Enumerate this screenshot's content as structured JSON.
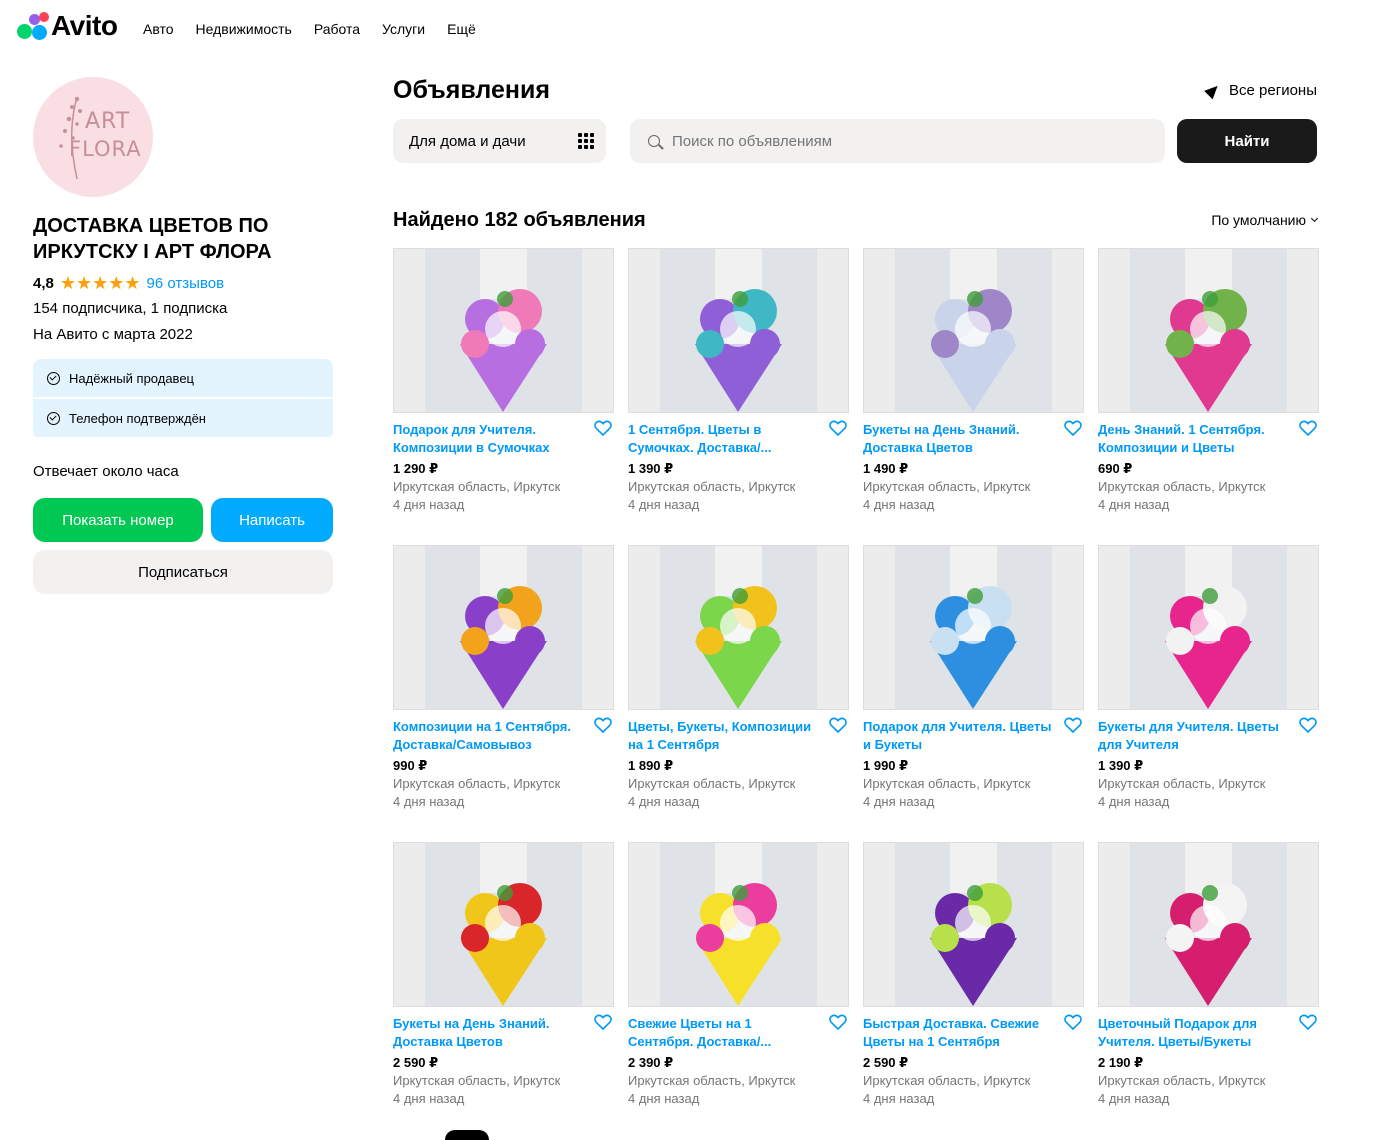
{
  "brand": {
    "logo_text": "Avito"
  },
  "nav": [
    "Авто",
    "Недвижимость",
    "Работа",
    "Услуги",
    "Ещё"
  ],
  "seller": {
    "avatar_text_1": "ART",
    "avatar_text_2": "FLORA",
    "name": "ДОСТАВКА ЦВЕТОВ ПО ИРКУТСКУ I АРТ ФЛОРА",
    "rating": "4,8",
    "stars": "★★★★★",
    "reviews": "96 отзывов",
    "subscribers": "154 подписчика, 1 подписка",
    "since": "На Авито с марта 2022",
    "badges": [
      "Надёжный продавец",
      "Телефон подтверждён"
    ],
    "reply_time": "Отвечает около часа",
    "show_phone": "Показать номер",
    "write": "Написать",
    "subscribe": "Подписаться"
  },
  "main": {
    "title": "Объявления",
    "region": "Все регионы",
    "category": "Для дома и дачи",
    "search_placeholder": "Поиск по объявлениям",
    "find": "Найти",
    "found": "Найдено 182 объявления",
    "sort": "По умолчанию"
  },
  "colors": {
    "accent_blue": "#0099f7",
    "green": "#00c853",
    "star": "#ffa000"
  },
  "listings": [
    {
      "title": "Подарок для Учителя. Композиции в Сумочках",
      "price": "1 290 ₽",
      "location": "Иркутская область, Иркутск",
      "date": "4 дня назад",
      "c1": "#b66ee0",
      "c2": "#f07ab8"
    },
    {
      "title": "1 Сентября. Цветы в Сумочках. Доставка/...",
      "price": "1 390 ₽",
      "location": "Иркутская область, Иркутск",
      "date": "4 дня назад",
      "c1": "#8e5fd6",
      "c2": "#3fb7c4"
    },
    {
      "title": "Букеты на День Знаний. Доставка Цветов",
      "price": "1 490 ₽",
      "location": "Иркутская область, Иркутск",
      "date": "4 дня назад",
      "c1": "#c9d4ea",
      "c2": "#9f86c9"
    },
    {
      "title": "День Знаний. 1 Сентября. Композиции и Цветы",
      "price": "690 ₽",
      "location": "Иркутская область, Иркутск",
      "date": "4 дня назад",
      "c1": "#e0398f",
      "c2": "#71b34a"
    },
    {
      "title": "Композиции на 1 Сентября. Доставка/Самовывоз",
      "price": "990 ₽",
      "location": "Иркутская область, Иркутск",
      "date": "4 дня назад",
      "c1": "#8a3fc9",
      "c2": "#f3a21c"
    },
    {
      "title": "Цветы, Букеты, Композиции на 1 Сентября",
      "price": "1 890 ₽",
      "location": "Иркутская область, Иркутск",
      "date": "4 дня назад",
      "c1": "#7cd64a",
      "c2": "#f1c21b"
    },
    {
      "title": "Подарок для Учителя. Цветы и Букеты",
      "price": "1 990 ₽",
      "location": "Иркутская область, Иркутск",
      "date": "4 дня назад",
      "c1": "#2c8fe0",
      "c2": "#c9dff2"
    },
    {
      "title": "Букеты для Учителя. Цветы для Учителя",
      "price": "1 390 ₽",
      "location": "Иркутская область, Иркутск",
      "date": "4 дня назад",
      "c1": "#e8248d",
      "c2": "#f2f2f2"
    },
    {
      "title": "Букеты на День Знаний. Доставка Цветов",
      "price": "2 590 ₽",
      "location": "Иркутская область, Иркутск",
      "date": "4 дня назад",
      "c1": "#f1c61b",
      "c2": "#d9262a"
    },
    {
      "title": "Свежие Цветы на 1 Сентября. Доставка/...",
      "price": "2 390 ₽",
      "location": "Иркутская область, Иркутск",
      "date": "4 дня назад",
      "c1": "#f7e02a",
      "c2": "#ea3d9e"
    },
    {
      "title": "Быстрая Доставка. Свежие Цветы на 1 Сентября",
      "price": "2 590 ₽",
      "location": "Иркутская область, Иркутск",
      "date": "4 дня назад",
      "c1": "#6a2aa8",
      "c2": "#b8e04a"
    },
    {
      "title": "Цветочный Подарок для Учителя. Цветы/Букеты",
      "price": "2 190 ₽",
      "location": "Иркутская область, Иркутск",
      "date": "4 дня назад",
      "c1": "#d61e6e",
      "c2": "#f4f4f4"
    }
  ]
}
